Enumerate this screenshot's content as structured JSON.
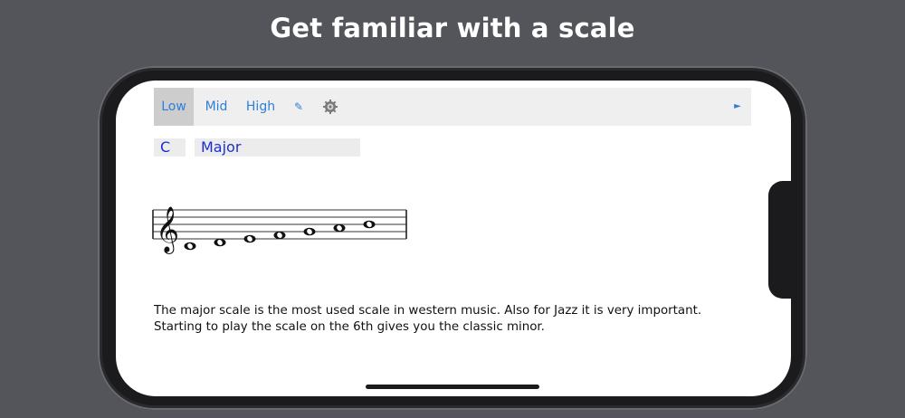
{
  "headline": "Get familiar with a scale",
  "toolbar": {
    "tabs": [
      {
        "label": "Low",
        "active": true
      },
      {
        "label": "Mid",
        "active": false
      },
      {
        "label": "High",
        "active": false
      }
    ],
    "edit_icon": "pencil-icon",
    "settings_icon": "gear-icon",
    "play_icon": "play-icon"
  },
  "selector": {
    "key": "C",
    "scale": "Major"
  },
  "notation": {
    "clef": "treble-clef-icon",
    "notes": [
      "C4",
      "D4",
      "E4",
      "F4",
      "G4",
      "A4",
      "B4"
    ]
  },
  "description": "The major scale is the most used scale in western music. Also for Jazz it is very important. Starting to play the scale on the 6th gives you the classic minor.",
  "colors": {
    "background": "#54555a",
    "accent": "#2f7fd8",
    "selector_text": "#1a2fd0",
    "toolbar_bg": "#efefef",
    "active_tab_bg": "#cdcdcd"
  }
}
